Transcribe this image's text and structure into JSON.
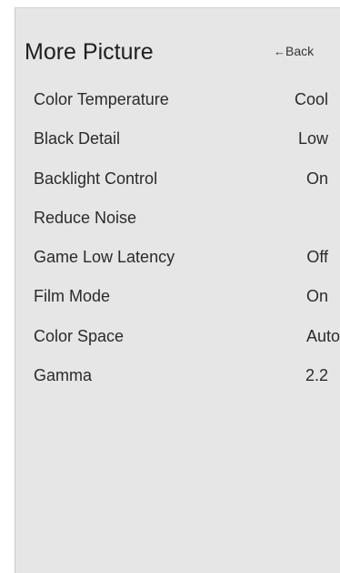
{
  "header": {
    "title": "More Picture",
    "back_arrow": "←",
    "back_label": "Back"
  },
  "menu": {
    "items": [
      {
        "label": "Color Temperature",
        "value": "Cool"
      },
      {
        "label": "Black Detail",
        "value": "Low"
      },
      {
        "label": "Backlight Control",
        "value": "On"
      },
      {
        "label": "Reduce Noise",
        "value": ""
      },
      {
        "label": "Game Low Latency",
        "value": "Off"
      },
      {
        "label": "Film Mode",
        "value": "On"
      },
      {
        "label": "Color Space",
        "value": "Auto"
      },
      {
        "label": "Gamma",
        "value": "2.2"
      }
    ]
  }
}
